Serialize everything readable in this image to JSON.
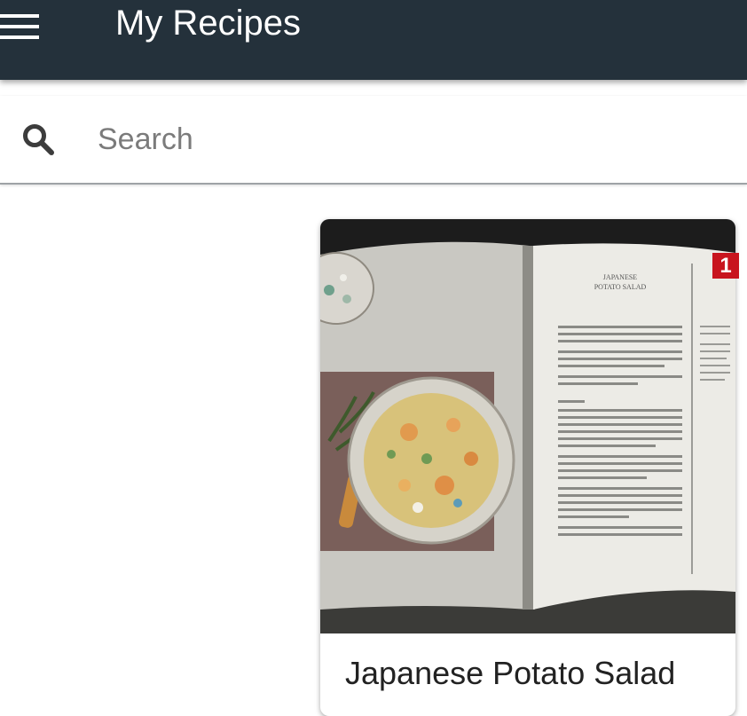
{
  "app": {
    "title": "My Recipes",
    "header_color": "#24313b",
    "menu_icon": "menu-icon"
  },
  "search": {
    "placeholder": "Search",
    "value": "",
    "icon": "search-icon"
  },
  "recipes": [
    {
      "title": "Japanese Potato Salad",
      "image": "open cookbook showing potato salad",
      "book_heading": [
        "JAPANESE",
        "POTATO SALAD"
      ],
      "badge": "1",
      "badge_color": "#c8141e"
    }
  ]
}
